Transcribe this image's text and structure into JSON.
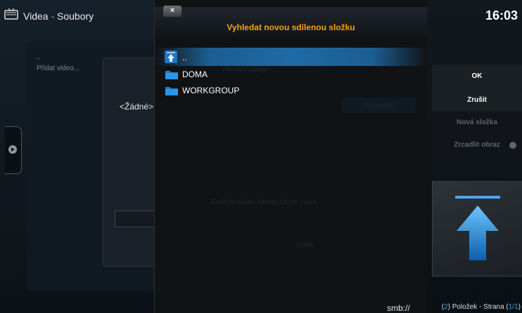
{
  "header": {
    "app": "Videa",
    "separator": "-",
    "section": "Soubory"
  },
  "background_list": {
    "items": [
      "..",
      "Přidat video..."
    ]
  },
  "background_dialog": {
    "value": "<Žádné>",
    "ghost_texts": [
      "Hledání zdroje",
      "Vyhledat",
      "Zrušit",
      "Zadejte název tohoto zdroje videa"
    ]
  },
  "dialog": {
    "close_label": "×",
    "title": "Vyhledat novou sdílenou složku",
    "files": [
      {
        "label": "..",
        "icon": "folder-up-icon",
        "selected": true
      },
      {
        "label": "DOMA",
        "icon": "folder-icon",
        "selected": false
      },
      {
        "label": "WORKGROUP",
        "icon": "folder-icon",
        "selected": false
      }
    ],
    "path": "smb://"
  },
  "clock": "16:03",
  "buttons": {
    "ok": "OK",
    "cancel": "Zrušit",
    "new_folder": "Nová složka",
    "mirror": "Zrcadlit obraz"
  },
  "status": {
    "count": "2",
    "items_label": "Položek - Strana",
    "page": "1/1"
  },
  "colors": {
    "accent": "#f5a21a",
    "selection": "#1e6aa6",
    "highlight": "#3f9bea"
  }
}
